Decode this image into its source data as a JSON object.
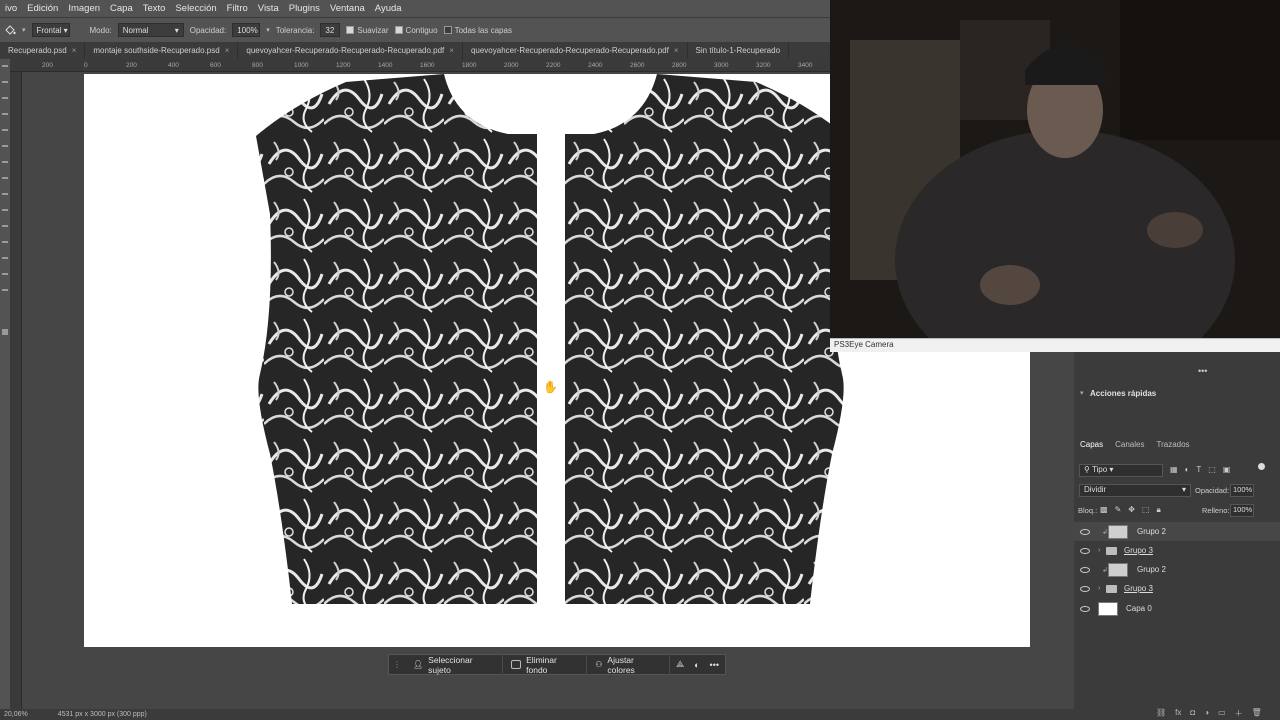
{
  "menu": [
    "ivo",
    "Edición",
    "Imagen",
    "Capa",
    "Texto",
    "Selección",
    "Filtro",
    "Vista",
    "Plugins",
    "Ventana",
    "Ayuda"
  ],
  "options": {
    "sample_mode": "Frontal",
    "mode_label": "Modo:",
    "mode_value": "Normal",
    "opacity_label": "Opacidad:",
    "opacity_value": "100%",
    "tolerance_label": "Tolerancia:",
    "tolerance_value": "32",
    "smooth_label": "Suavizar",
    "contiguous_label": "Contiguo",
    "all_layers_label": "Todas las capas"
  },
  "tabs": [
    "Recuperado.psd",
    "montaje southside-Recuperado.psd",
    "quevoyahcer-Recuperado-Recuperado-Recuperado.pdf",
    "quevoyahcer-Recuperado-Recuperado-Recuperado.pdf",
    "Sin título-1-Recuperado"
  ],
  "ruler_ticks": [
    "200",
    "0",
    "200",
    "400",
    "600",
    "800",
    "1000",
    "1200",
    "1400",
    "1600",
    "1800",
    "2000",
    "2200",
    "2400",
    "2600",
    "2800",
    "3000",
    "3200",
    "3400"
  ],
  "webcam_label": "PS3Eye Camera",
  "right_panel": {
    "quick_actions": "Acciones rápidas",
    "tabs": [
      "Capas",
      "Canales",
      "Trazados"
    ],
    "filter_label": "Tipo",
    "blend_mode": "Dividir",
    "opacity_label": "Opacidad:",
    "opacity_value": "100%",
    "lock_label": "Bloq.:",
    "fill_label": "Relleno:",
    "fill_value": "100%",
    "layers": [
      {
        "name": "Grupo 2",
        "kind": "smart"
      },
      {
        "name": "Grupo 3",
        "kind": "folder"
      },
      {
        "name": "Grupo 2",
        "kind": "smart"
      },
      {
        "name": "Grupo 3",
        "kind": "folder"
      },
      {
        "name": "Capa 0",
        "kind": "plain"
      }
    ]
  },
  "context_bar": {
    "select_subject": "Seleccionar sujeto",
    "remove_bg": "Eliminar fondo",
    "adjust_colors": "Ajustar colores"
  },
  "status": {
    "zoom": "20,06%",
    "doc_size": "4531 px x 3000 px (300 ppp)"
  }
}
